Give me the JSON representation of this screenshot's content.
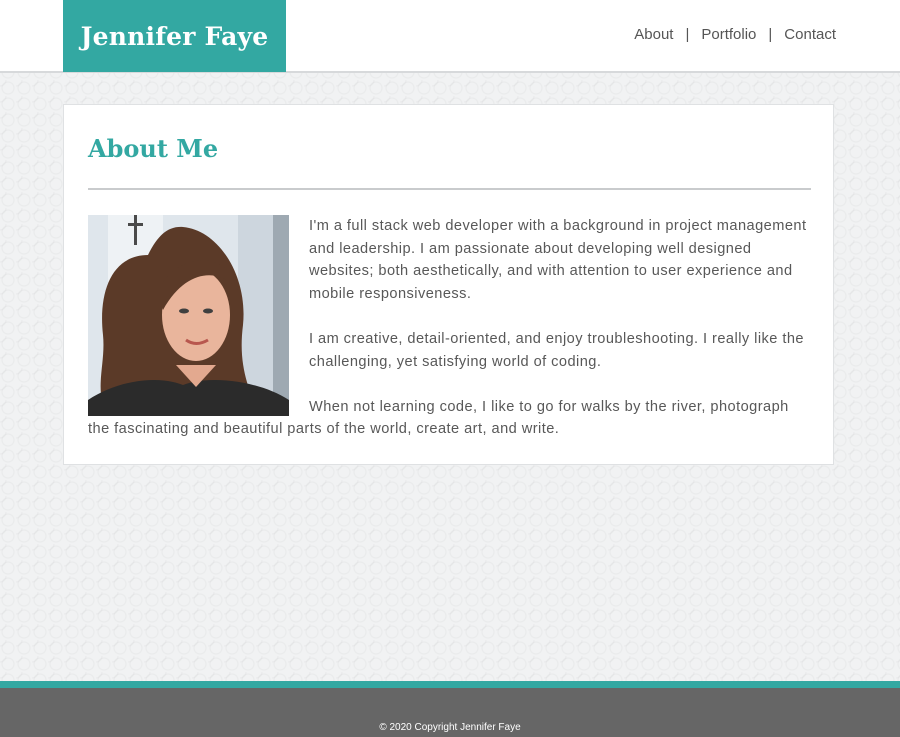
{
  "header": {
    "brand": "Jennifer Faye",
    "nav": [
      {
        "label": "About"
      },
      {
        "label": "Portfolio"
      },
      {
        "label": "Contact"
      }
    ],
    "separator": "|"
  },
  "main": {
    "title": "About Me",
    "paragraphs": [
      "I'm a full stack web developer with a background in project management and leadership. I am passionate about developing well designed websites; both aesthetically, and with attention to user experience and mobile responsiveness.",
      "I am creative, detail-oriented, and enjoy troubleshooting. I really like the challenging, yet satisfying world of coding.",
      "When not learning code, I like to go for walks by the river, photograph the fascinating and beautiful parts of the world, create art, and write."
    ]
  },
  "footer": {
    "copyright": "© 2020 Copyright Jennifer Faye"
  },
  "colors": {
    "accent": "#33a8a2",
    "footer_bg": "#666666",
    "text": "#585858"
  }
}
